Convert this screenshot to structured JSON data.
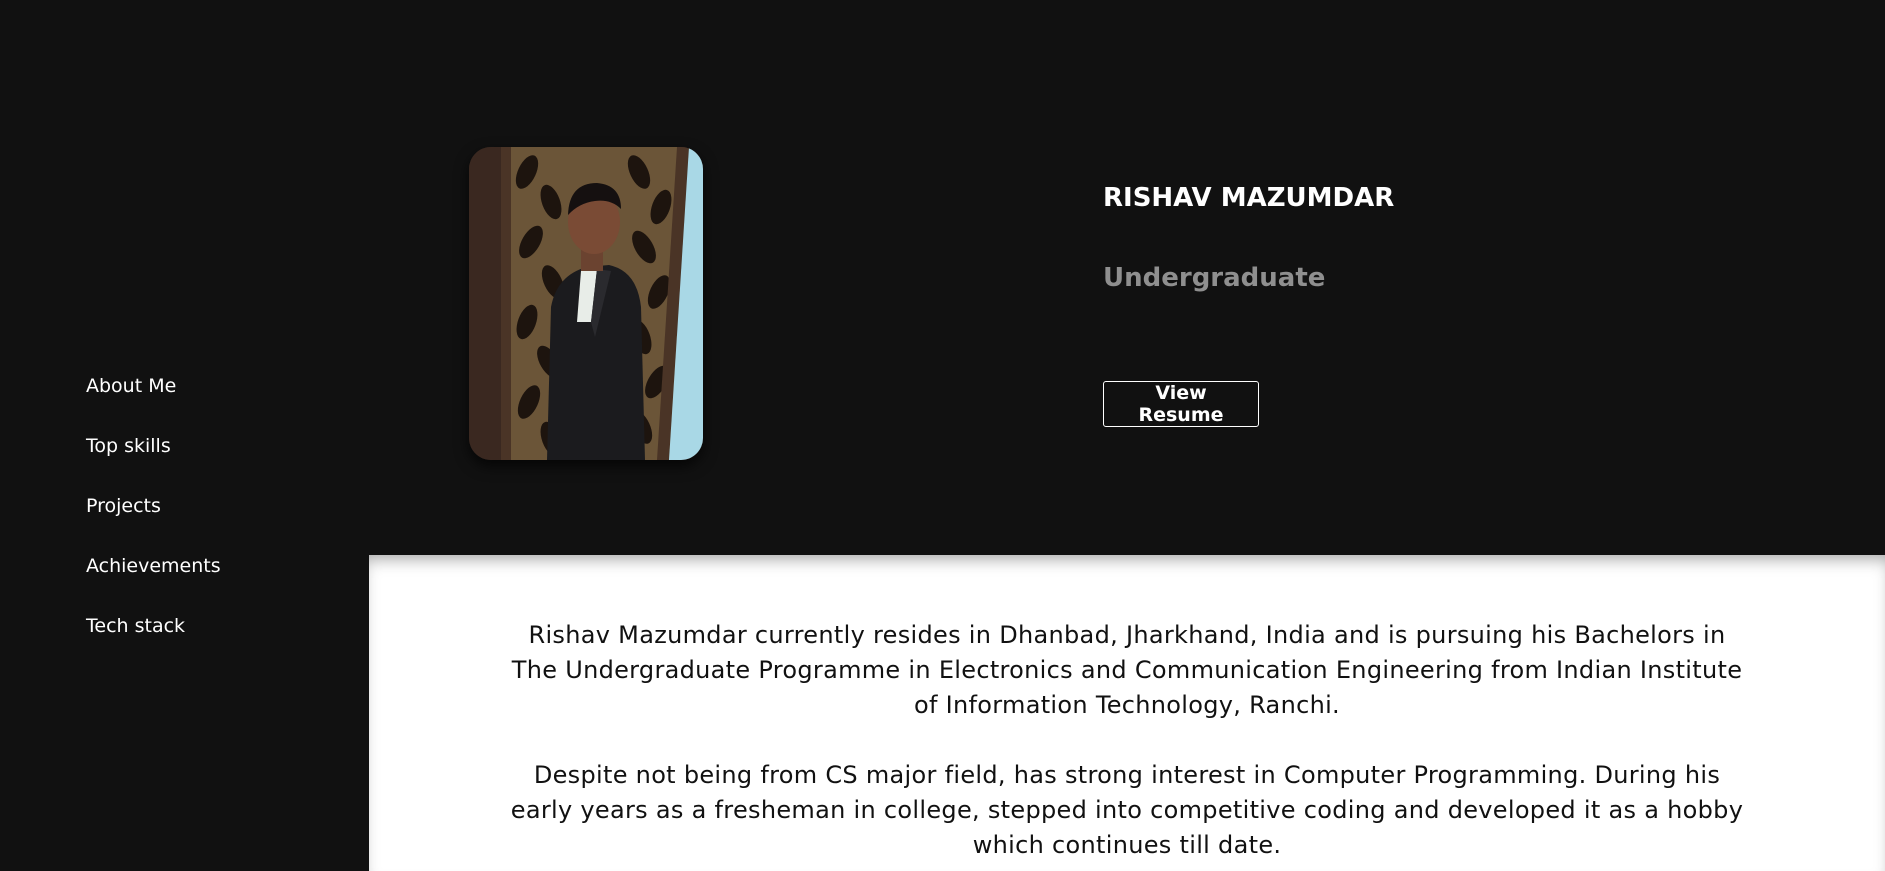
{
  "sidebar": {
    "items": [
      {
        "label": "About Me"
      },
      {
        "label": "Top skills"
      },
      {
        "label": "Projects"
      },
      {
        "label": "Achievements"
      },
      {
        "label": "Tech stack"
      }
    ]
  },
  "hero": {
    "name": "RISHAV MAZUMDAR",
    "role": "Undergraduate",
    "resume_label": "View Resume"
  },
  "about": {
    "paragraphs": [
      "Rishav Mazumdar currently resides in Dhanbad, Jharkhand, India and is pursuing his Bachelors in The Undergraduate Programme in Electronics and Communication Engineering from Indian Institute of Information Technology, Ranchi.",
      "Despite not being from CS major field, has strong interest in Computer Programming. During his early years as a fresheman in college, stepped into competitive coding and developed it as a hobby which continues till date."
    ]
  },
  "colors": {
    "background": "#111111",
    "text_light": "#ffffff",
    "text_muted": "#8f8f8f",
    "content_bg": "#ffffff"
  }
}
